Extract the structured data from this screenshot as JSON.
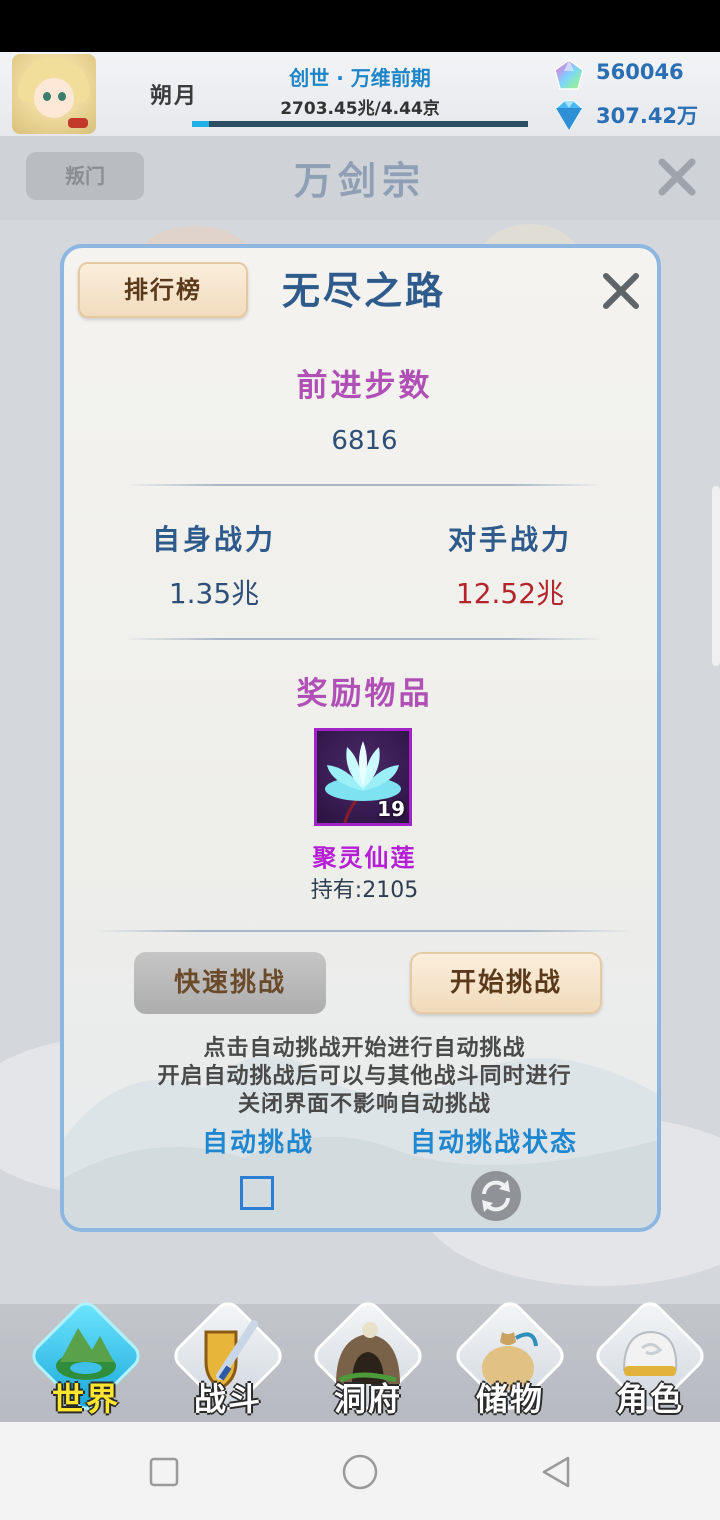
{
  "header": {
    "player_name": "朔月",
    "realm": "创世 · 万维前期",
    "exp_text": "2703.45兆/4.44京",
    "exp_progress": 0.05,
    "currency_1": "560046",
    "currency_2": "307.42万",
    "currency_1_icon": "rainbow-gem-icon",
    "currency_2_icon": "blue-gem-icon"
  },
  "sect": {
    "rebel_label": "叛门",
    "title": "万剑宗"
  },
  "modal": {
    "rank_label": "排行榜",
    "title": "无尽之路",
    "steps_title": "前进步数",
    "steps_value": "6816",
    "self_power_label": "自身战力",
    "self_power_value": "1.35兆",
    "opp_power_label": "对手战力",
    "opp_power_value": "12.52兆",
    "reward_title": "奖励物品",
    "reward_item": {
      "name": "聚灵仙莲",
      "count": "19",
      "held": "持有:2105",
      "icon": "lotus-icon"
    },
    "quick_challenge_label": "快速挑战",
    "start_challenge_label": "开始挑战",
    "tips": [
      "点击自动挑战开始进行自动挑战",
      "开启自动挑战后可以与其他战斗同时进行",
      "关闭界面不影响自动挑战"
    ],
    "auto_challenge_label": "自动挑战",
    "auto_status_label": "自动挑战状态",
    "auto_checked": false
  },
  "nav": {
    "items": [
      {
        "label": "世界",
        "icon": "world-island-icon",
        "active": true
      },
      {
        "label": "战斗",
        "icon": "sword-shield-icon",
        "active": false
      },
      {
        "label": "洞府",
        "icon": "cave-icon",
        "active": false
      },
      {
        "label": "储物",
        "icon": "storage-bag-icon",
        "active": false
      },
      {
        "label": "角色",
        "icon": "character-hat-icon",
        "active": false
      }
    ]
  },
  "colors": {
    "accent_blue": "#1f86d0",
    "title_purple": "#b050b6",
    "item_purple": "#b51ed6",
    "opponent_red": "#b4252b",
    "modal_border": "#8db7e0"
  }
}
